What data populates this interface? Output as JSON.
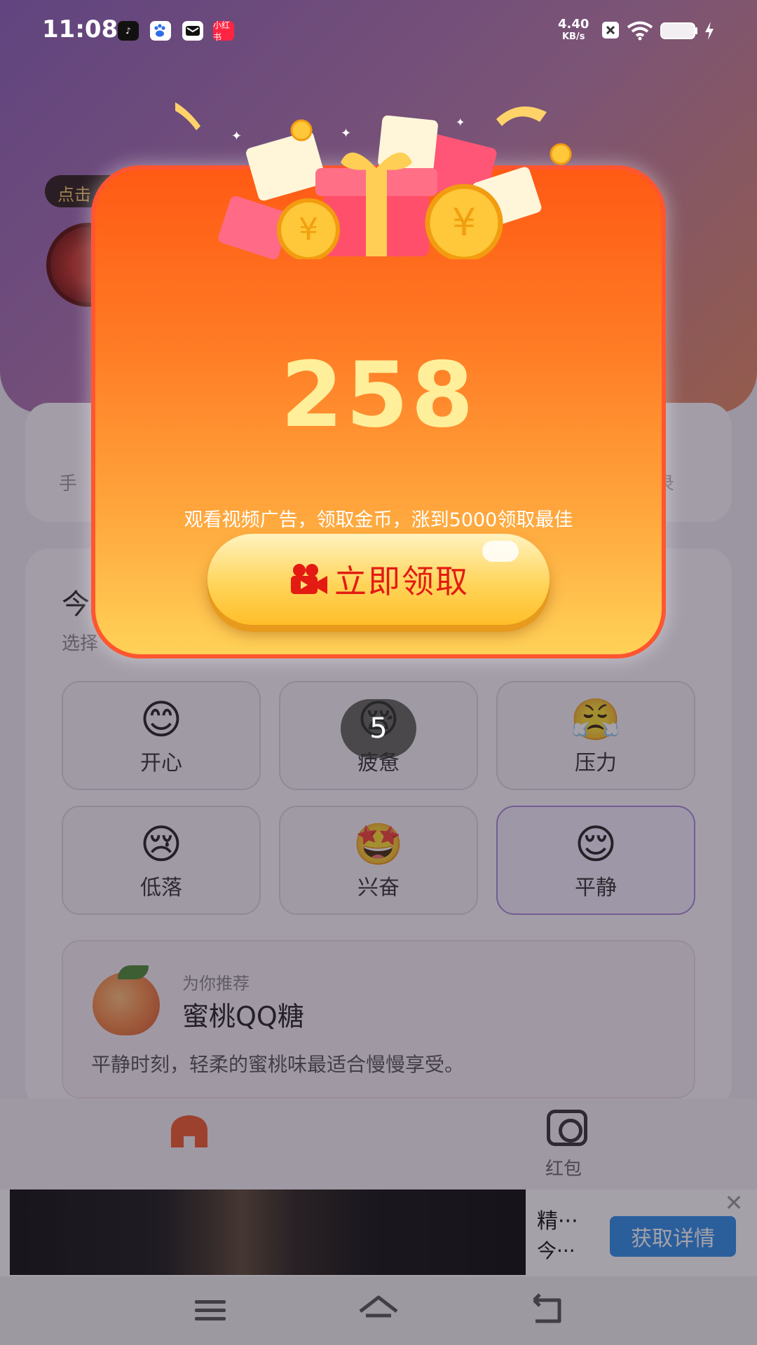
{
  "status_bar": {
    "time": "11:08",
    "app_badges": [
      {
        "icon": "tiktok-icon",
        "text": "",
        "color": "#111111"
      },
      {
        "icon": "baidu-icon",
        "text": "",
        "color": "#2e6ee6"
      },
      {
        "icon": "mail-icon",
        "text": "",
        "color": "#111111"
      },
      {
        "icon": "xiaohongshu-icon",
        "text": "小红书",
        "color": "#ff2442"
      }
    ],
    "net_speed_value": "4.40",
    "net_speed_unit": "KB/s"
  },
  "background": {
    "hint_pill": "点击",
    "stat_left_fragment": "手",
    "stat_right_fragment": "录",
    "mood_title": "今",
    "mood_subtitle": "选择",
    "moods": [
      {
        "emoji": "😊",
        "label": "开心",
        "selected": false
      },
      {
        "emoji": "😪",
        "label": "疲惫",
        "selected": false
      },
      {
        "emoji": "😤",
        "label": "压力",
        "selected": false
      },
      {
        "emoji": "😢",
        "label": "低落",
        "selected": false
      },
      {
        "emoji": "🤩",
        "label": "兴奋",
        "selected": false
      },
      {
        "emoji": "😌",
        "label": "平静",
        "selected": true
      }
    ],
    "recommendation": {
      "tag": "为你推荐",
      "name": "蜜桃QQ糖",
      "description": "平静时刻，轻柔的蜜桃味最适合慢慢享受。"
    }
  },
  "bottom_nav": {
    "home_icon": "home-icon",
    "redpack_label": "红包",
    "redpack_icon": "red-packet-icon"
  },
  "ad": {
    "title": "精···",
    "subtitle": "今···",
    "cta": "获取详情"
  },
  "modal": {
    "amount": "258",
    "instruction": "观看视频广告，领取金币，涨到5000领取最佳",
    "claim_label": "立即领取",
    "claim_icon": "video-camera-icon",
    "colors": {
      "top": "#ff5a14",
      "bottom": "#ffd257",
      "amount": "#ffef9a",
      "button_text": "#e31b12"
    }
  },
  "countdown": "5"
}
